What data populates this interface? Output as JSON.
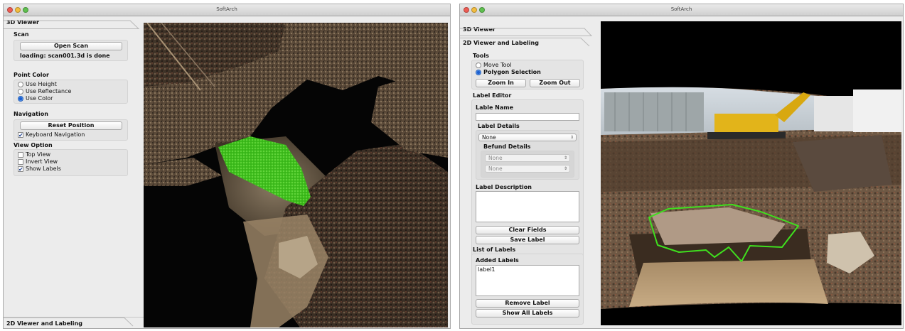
{
  "left_window": {
    "title": "SoftArch",
    "tab_3d": "3D Viewer",
    "tab_2d": "2D Viewer and Labeling",
    "scan": {
      "title": "Scan",
      "open_button": "Open Scan",
      "status": "loading: scan001.3d is done"
    },
    "point_color": {
      "title": "Point Color",
      "options": [
        "Use Height",
        "Use Reflectance",
        "Use Color"
      ],
      "selected": "Use Color"
    },
    "navigation": {
      "title": "Navigation",
      "reset_button": "Reset Position",
      "keyboard_nav": "Keyboard Navigation",
      "keyboard_nav_checked": true
    },
    "view_option": {
      "title": "View Option",
      "options": [
        {
          "label": "Top View",
          "checked": false
        },
        {
          "label": "Invert View",
          "checked": false
        },
        {
          "label": "Show Labels",
          "checked": true
        }
      ]
    },
    "highlight_color": "#44d21c"
  },
  "right_window": {
    "title": "SoftArch",
    "tab_3d": "3D Viewer",
    "tab_2d": "2D Viewer and Labeling",
    "tools": {
      "title": "Tools",
      "options": [
        "Move Tool",
        "Polygon Selection"
      ],
      "selected": "Polygon Selection",
      "zoom_in": "Zoom In",
      "zoom_out": "Zoom Out"
    },
    "label_editor": {
      "title": "Label Editor",
      "name_label": "Lable Name",
      "name_value": "",
      "details_title": "Label Details",
      "details_select": "None",
      "befund_title": "Befund Details",
      "befund_select_1": "None",
      "befund_select_2": "None",
      "description_label": "Label Description",
      "description_value": "",
      "clear_button": "Clear Fields",
      "save_button": "Save Label"
    },
    "list_of_labels": {
      "title": "List of Labels",
      "added_title": "Added Labels",
      "items": [
        "label1"
      ],
      "remove_button": "Remove Label",
      "show_all_button": "Show All Labels"
    },
    "polygon_color": "#3fe01e"
  }
}
